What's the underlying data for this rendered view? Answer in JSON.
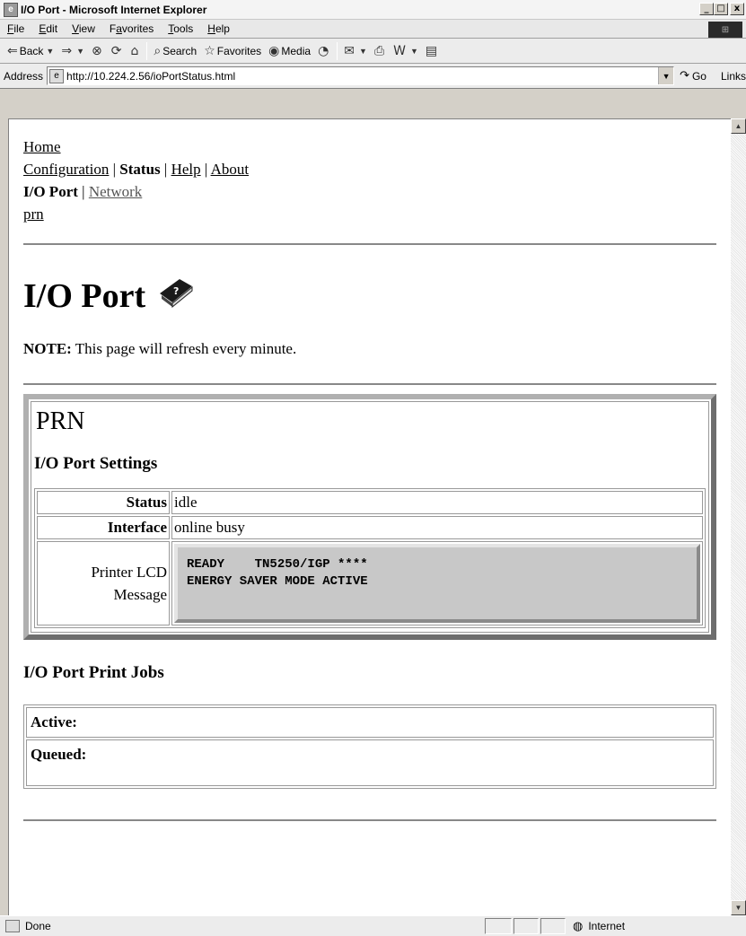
{
  "window": {
    "title": "I/O Port - Microsoft Internet Explorer",
    "buttons": {
      "minimize": "_",
      "maximize": "□",
      "close": "x"
    }
  },
  "menubar": {
    "items": [
      {
        "label": "File",
        "key": "F",
        "rest": "ile"
      },
      {
        "label": "Edit",
        "key": "E",
        "rest": "dit"
      },
      {
        "label": "View",
        "key": "V",
        "rest": "iew"
      },
      {
        "label": "Favorites",
        "pre": "F",
        "key": "a",
        "rest": "vorites"
      },
      {
        "label": "Tools",
        "key": "T",
        "rest": "ools"
      },
      {
        "label": "Help",
        "key": "H",
        "rest": "elp"
      }
    ]
  },
  "toolbar": {
    "back_label": "Back",
    "search_label": "Search",
    "favorites_label": "Favorites",
    "media_label": "Media"
  },
  "addressbar": {
    "label": "Address",
    "url": "http://10.224.2.56/ioPortStatus.html",
    "go_label": "Go",
    "links_label": "Links"
  },
  "nav": {
    "home": "Home",
    "configuration": "Configuration",
    "status": "Status",
    "help": "Help",
    "about": "About",
    "io_port": "I/O Port",
    "network": "Network",
    "prn": "prn",
    "separator": "|"
  },
  "page": {
    "title": "I/O Port",
    "note_label": "NOTE:",
    "note_text": "This page will refresh every minute."
  },
  "prn_section": {
    "title": "PRN",
    "settings_heading": "I/O Port Settings",
    "rows": [
      {
        "label": "Status",
        "value": "idle"
      },
      {
        "label": "Interface",
        "value": "online busy"
      }
    ],
    "lcd_label_line1": "Printer LCD",
    "lcd_label_line2": "Message",
    "lcd_line1": "READY    TN5250/IGP ****",
    "lcd_line2": "ENERGY SAVER MODE ACTIVE"
  },
  "jobs_section": {
    "heading": "I/O Port Print Jobs",
    "active_label": "Active:",
    "queued_label": "Queued:"
  },
  "statusbar": {
    "status_text": "Done",
    "zone_text": "Internet"
  }
}
